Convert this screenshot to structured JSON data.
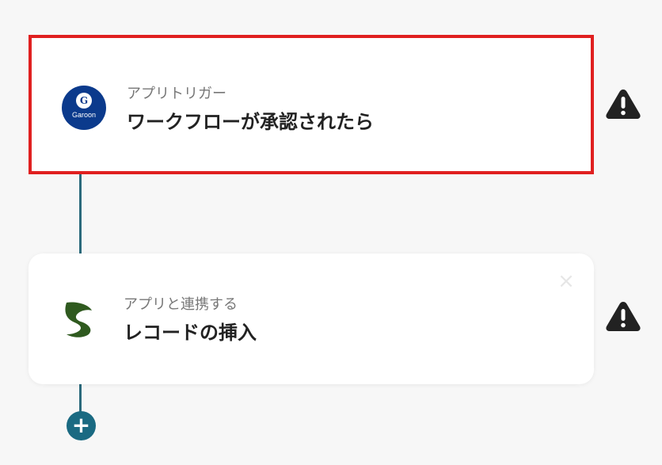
{
  "flow": {
    "trigger": {
      "app_name": "Garoon",
      "app_logo_letter": "G",
      "subtitle": "アプリトリガー",
      "title": "ワークフローが承認されたら",
      "status_icon": "warning-icon",
      "highlight_color": "#e02020"
    },
    "action": {
      "app_logo_icon": "kintone-s-logo",
      "subtitle": "アプリと連携する",
      "title": "レコードの挿入",
      "close_icon": "×",
      "status_icon": "warning-icon"
    },
    "add_step_label": "+"
  },
  "colors": {
    "connector": "#2b6a7c",
    "add_button": "#1a6a82",
    "garoon_blue": "#0b3a8c",
    "kintone_green": "#2f5a1f"
  }
}
